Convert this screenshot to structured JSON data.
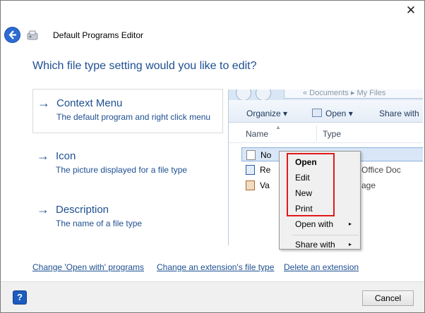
{
  "window": {
    "title": "Default Programs Editor",
    "close_symbol": "✕"
  },
  "heading": "Which file type setting would you like to edit?",
  "options": [
    {
      "arrow": "→",
      "title": "Context Menu",
      "description": "The default program and right click menu"
    },
    {
      "arrow": "→",
      "title": "Icon",
      "description": "The picture displayed for a file type"
    },
    {
      "arrow": "→",
      "title": "Description",
      "description": "The name of a file type"
    }
  ],
  "preview": {
    "address": "«  Documents  ▸  My Files",
    "toolbar": {
      "organize": "Organize ▾",
      "open": "Open ▾",
      "share": "Share with"
    },
    "columns": {
      "name": "Name",
      "type": "Type"
    },
    "rows": [
      {
        "name": "No",
        "type": ""
      },
      {
        "name": "Re",
        "type": "Office Doc"
      },
      {
        "name": "Va",
        "type": "age"
      }
    ],
    "context_menu": [
      {
        "label": "Open",
        "bold": true,
        "submenu": false
      },
      {
        "label": "Edit",
        "bold": false,
        "submenu": false
      },
      {
        "label": "New",
        "bold": false,
        "submenu": false
      },
      {
        "label": "Print",
        "bold": false,
        "submenu": false
      },
      {
        "label": "Open with",
        "bold": false,
        "submenu": true
      },
      {
        "label": "Share with",
        "bold": false,
        "submenu": true
      }
    ],
    "submenu_arrow": "▸"
  },
  "links": {
    "change_open_with": "Change 'Open with' programs",
    "change_extension": "Change an extension's file type",
    "delete_extension": "Delete an extension"
  },
  "footer": {
    "help_label": "?",
    "cancel_label": "Cancel"
  },
  "colors": {
    "accent_blue": "#1e4f91",
    "highlight_red": "#e0191b"
  }
}
